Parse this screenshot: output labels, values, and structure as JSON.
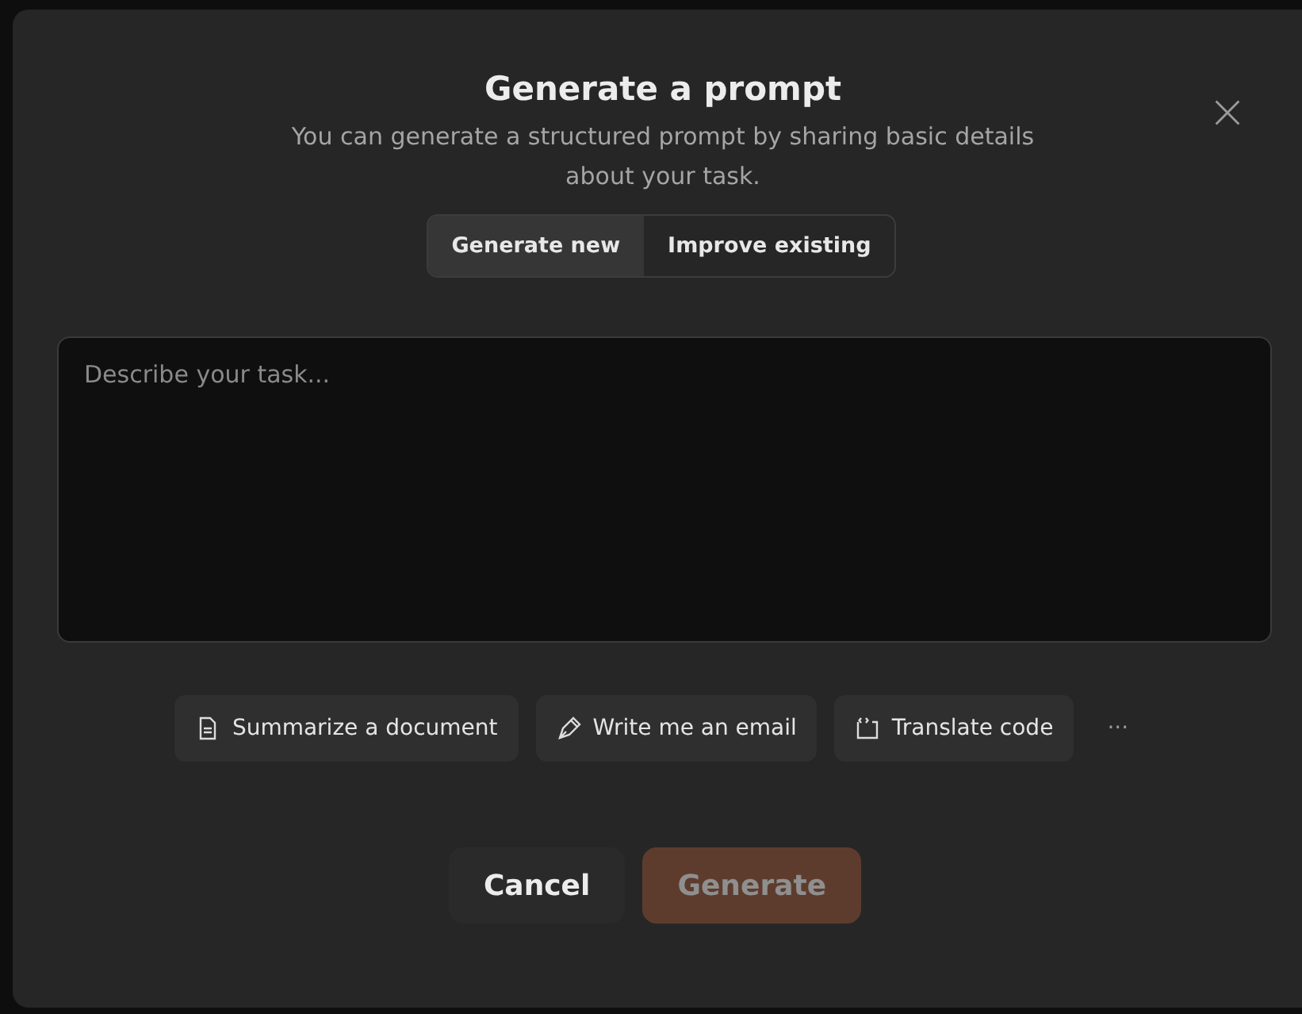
{
  "dialog": {
    "title": "Generate a prompt",
    "subtitle": "You can generate a structured prompt by sharing basic details about your task.",
    "tabs": [
      {
        "label": "Generate new",
        "selected": true
      },
      {
        "label": "Improve existing",
        "selected": false
      }
    ],
    "task": {
      "placeholder": "Describe your task..."
    },
    "suggestions": [
      {
        "kind": "document",
        "label": "Summarize a document"
      },
      {
        "kind": "pen",
        "label": "Write me an email"
      },
      {
        "kind": "code",
        "label": "Translate code"
      }
    ],
    "more": "···",
    "cancel": "Cancel",
    "generate": {
      "label": "Generate",
      "disabled": true
    }
  }
}
